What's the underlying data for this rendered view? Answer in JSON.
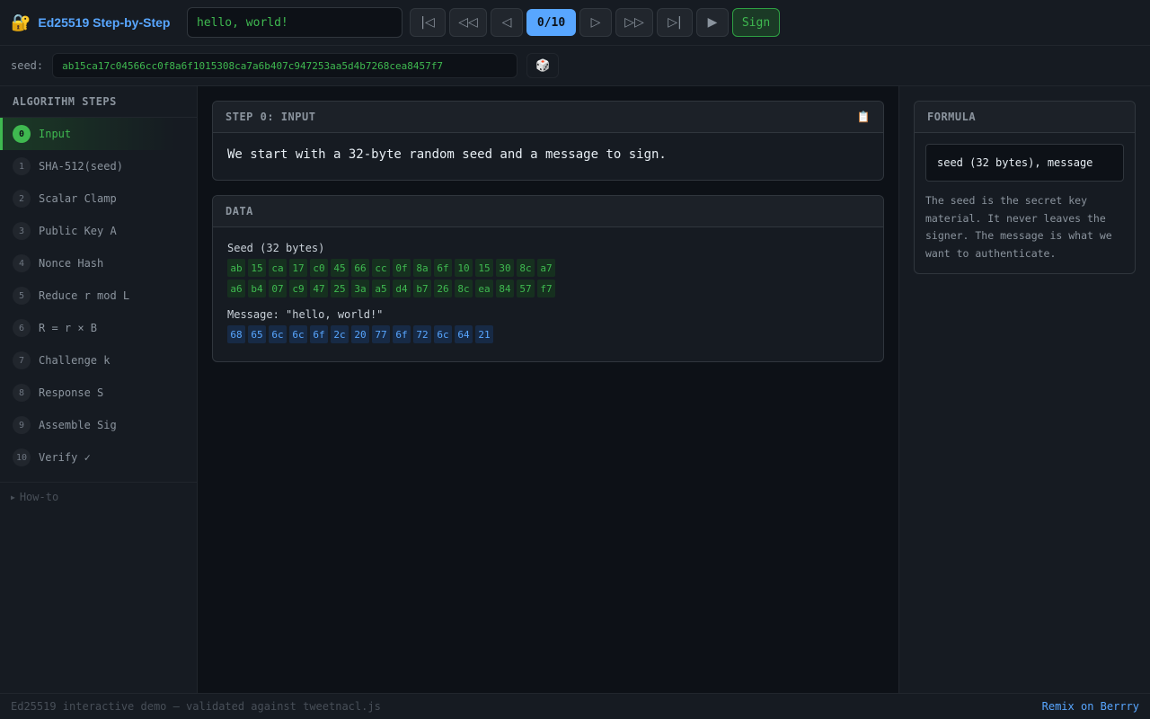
{
  "app": {
    "title": "Ed25519 Step-by-Step",
    "icon": "lock-with-key-icon"
  },
  "toolbar": {
    "message_value": "hello, world!",
    "first_label": "|◁",
    "rewind_label": "◁◁",
    "prev_label": "◁",
    "step_counter": "0/10",
    "next_label": "▷",
    "forward_label": "▷▷",
    "last_label": "▷|",
    "play_label": "▶",
    "sign_label": "Sign"
  },
  "seed": {
    "label": "seed:",
    "value": "ab15ca17c04566cc0f8a6f1015308ca7a6b407c947253aa5d4b7268cea8457f7",
    "dice_icon": "🎲"
  },
  "sidebar": {
    "header": "ALGORITHM STEPS",
    "items": [
      {
        "num": "0",
        "label": "Input"
      },
      {
        "num": "1",
        "label": "SHA-512(seed)"
      },
      {
        "num": "2",
        "label": "Scalar Clamp"
      },
      {
        "num": "3",
        "label": "Public Key A"
      },
      {
        "num": "4",
        "label": "Nonce Hash"
      },
      {
        "num": "5",
        "label": "Reduce r mod L"
      },
      {
        "num": "6",
        "label": "R = r × B"
      },
      {
        "num": "7",
        "label": "Challenge k"
      },
      {
        "num": "8",
        "label": "Response S"
      },
      {
        "num": "9",
        "label": "Assemble Sig"
      },
      {
        "num": "10",
        "label": "Verify ✓"
      }
    ],
    "active_index": 0,
    "howto_label": "How-to"
  },
  "step_card": {
    "title": "STEP 0: INPUT",
    "description": "We start with a 32-byte random seed and a message to sign."
  },
  "data_card": {
    "title": "DATA",
    "seed_label": "Seed (32 bytes)",
    "seed_row1": [
      "ab",
      "15",
      "ca",
      "17",
      "c0",
      "45",
      "66",
      "cc",
      "0f",
      "8a",
      "6f",
      "10",
      "15",
      "30",
      "8c",
      "a7"
    ],
    "seed_row2": [
      "a6",
      "b4",
      "07",
      "c9",
      "47",
      "25",
      "3a",
      "a5",
      "d4",
      "b7",
      "26",
      "8c",
      "ea",
      "84",
      "57",
      "f7"
    ],
    "message_label": "Message: \"hello, world!\"",
    "message_bytes": [
      "68",
      "65",
      "6c",
      "6c",
      "6f",
      "2c",
      "20",
      "77",
      "6f",
      "72",
      "6c",
      "64",
      "21"
    ]
  },
  "formula": {
    "title": "FORMULA",
    "expression": "seed (32 bytes), message",
    "note": "The seed is the secret key material. It never leaves the signer. The message is what we want to authenticate."
  },
  "footer": {
    "text": "Ed25519 interactive demo — validated against tweetnacl.js",
    "link": "Remix on Berrry"
  },
  "colors": {
    "accent_blue": "#58a6ff",
    "accent_green": "#3fb950",
    "bg": "#0d1117",
    "panel": "#161b22"
  }
}
